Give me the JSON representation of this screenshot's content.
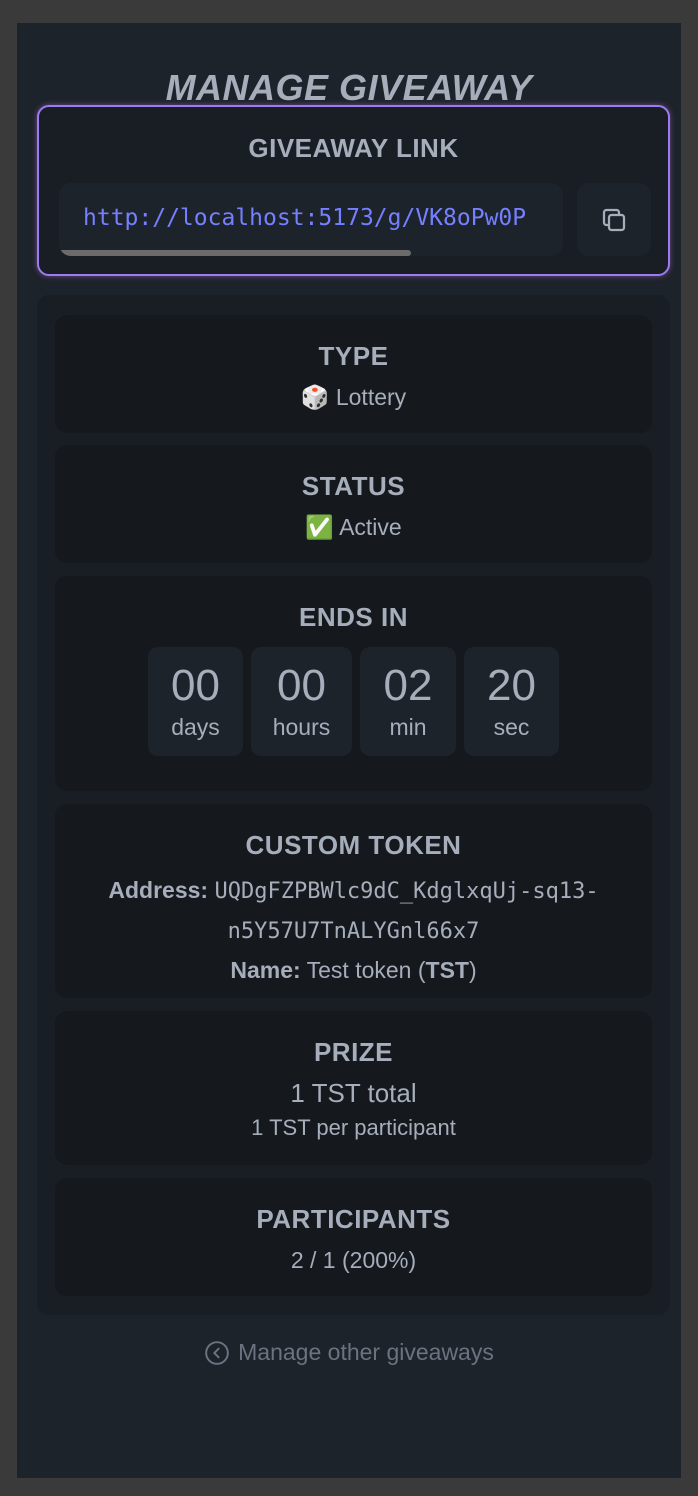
{
  "page": {
    "title": "MANAGE GIVEAWAY"
  },
  "link_card": {
    "heading": "GIVEAWAY LINK",
    "url": "http://localhost:5173/g/VK8oPw0P",
    "copy_icon": "copy-icon"
  },
  "stats": {
    "type": {
      "title": "TYPE",
      "emoji": "🎲",
      "value": "Lottery"
    },
    "status": {
      "title": "STATUS",
      "emoji": "✅",
      "value": "Active"
    },
    "ends_in": {
      "title": "ENDS IN",
      "units": [
        {
          "value": "00",
          "label": "days"
        },
        {
          "value": "00",
          "label": "hours"
        },
        {
          "value": "02",
          "label": "min"
        },
        {
          "value": "20",
          "label": "sec"
        }
      ]
    },
    "custom_token": {
      "title": "CUSTOM TOKEN",
      "address_label": "Address:",
      "address_line1": "UQDgFZPBWlc9dC_KdglxqUj-sq13-",
      "address_line2": "n5Y57U7TnALYGnl66x7",
      "name_label": "Name:",
      "name_value": "Test token (",
      "name_symbol": "TST",
      "name_close": ")"
    },
    "prize": {
      "title": "PRIZE",
      "total": "1 TST total",
      "per_participant": "1 TST per participant"
    },
    "participants": {
      "title": "PARTICIPANTS",
      "value": "2 / 1 (200%)"
    }
  },
  "footer": {
    "manage_other_label": "Manage other giveaways"
  },
  "colors": {
    "accent_link": "#7480ff",
    "border_glow": "#9b7cf0",
    "background": "#1d232a",
    "card": "#15191e"
  }
}
